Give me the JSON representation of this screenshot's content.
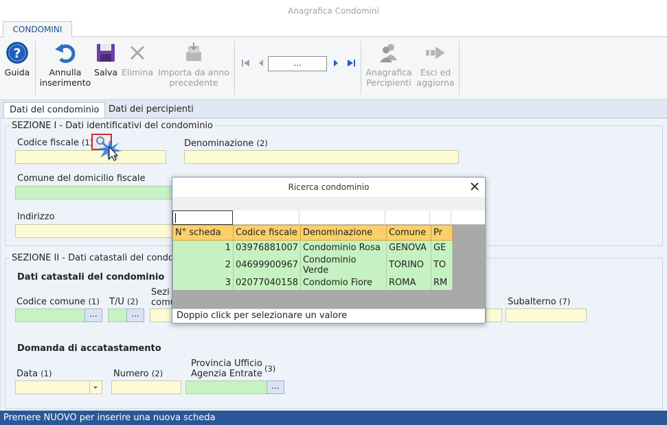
{
  "window": {
    "title": "Anagrafica Condomini"
  },
  "ribbon": {
    "tab": "CONDOMINI",
    "guida": "Guida",
    "annulla_1": "Annulla",
    "annulla_2": "inserimento",
    "salva": "Salva",
    "elimina": "Elimina",
    "importa_1": "Importa da anno",
    "importa_2": "precedente",
    "nav_value": "...",
    "percipienti_1": "Anagrafica",
    "percipienti_2": "Percipienti",
    "esci_1": "Esci ed",
    "esci_2": "aggiorna"
  },
  "tabs": {
    "dati_condominio": "Dati del condominio",
    "dati_percipienti": "Dati dei percipienti"
  },
  "sezione1": {
    "legend": "SEZIONE I - Dati identificativi del condominio",
    "codice_fiscale": "Codice fiscale",
    "codice_fiscale_n": "(1)",
    "denominazione": "Denominazione",
    "denominazione_n": "(2)",
    "comune": "Comune del domicilio fiscale",
    "indirizzo": "Indirizzo"
  },
  "sezione2": {
    "legend": "SEZIONE II - Dati catastali del condominio",
    "subtitle": "Dati catastali del condominio",
    "codice_comune": "Codice comune",
    "codice_comune_n": "(1)",
    "tu": "T/U",
    "tu_n": "(2)",
    "sezione_1": "Sezi",
    "sezione_2": "comu",
    "subalterno": "Subalterno",
    "subalterno_n": "(7)",
    "domanda": "Domanda di accatastamento",
    "data": "Data",
    "data_n": "(1)",
    "numero": "Numero",
    "numero_n": "(2)",
    "provincia_1": "Provincia Ufficio",
    "provincia_2": "Agenzia Entrate",
    "provincia_n": "(3)",
    "dots": "..."
  },
  "dialog": {
    "title": "Ricerca condominio",
    "columns": [
      "N° scheda",
      "Codice fiscale",
      "Denominazione",
      "Comune",
      "Pr"
    ],
    "rows": [
      [
        "1",
        "03976881007",
        "Condominio Rosa",
        "GENOVA",
        "GE"
      ],
      [
        "2",
        "04699900967",
        "Condominio Verde",
        "TORINO",
        "TO"
      ],
      [
        "3",
        "02077040158",
        "Condomio Fiore",
        "ROMA",
        "RM"
      ]
    ],
    "footer": "Doppio click per selezionare un valore"
  },
  "status": {
    "text": "Premere NUOVO per inserire una nuova scheda"
  }
}
